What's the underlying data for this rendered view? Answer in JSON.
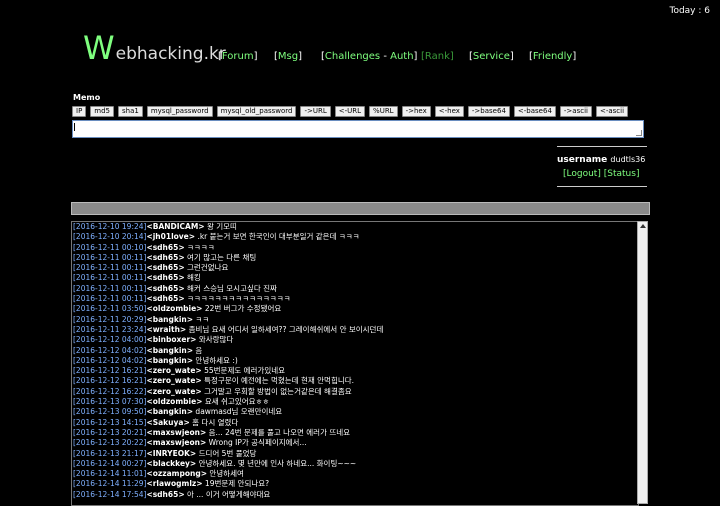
{
  "header": {
    "today": "Today : 6",
    "logo_big": "W",
    "logo_rest": "ebhacking.kr"
  },
  "nav": {
    "forum": "Forum",
    "msg": "Msg",
    "challenges": "Challenges",
    "dash": "-",
    "auth": "Auth",
    "rank": "Rank",
    "service": "Service",
    "friendly": "Friendly"
  },
  "memo": {
    "label": "Memo",
    "buttons": [
      "IP",
      "md5",
      "sha1",
      "mysql_password",
      "mysql_old_password",
      "->URL",
      "<-URL",
      "%URL",
      "->hex",
      "<-hex",
      "->base64",
      "<-base64",
      "->ascii",
      "<-ascii"
    ],
    "value": ""
  },
  "user": {
    "username_label": "username",
    "username_value": "dudtls36",
    "logout": "Logout",
    "status": "Status"
  },
  "chat": [
    {
      "ts": "[2016-12-10 19:24]",
      "name": "<BANDICAM>",
      "msg": " 왕 기모띠"
    },
    {
      "ts": "[2016-12-10 20:14]",
      "name": "<jh01love>",
      "msg": " .kr 붙는거 보면 한국인이 대부분일거 같은데 ㅋㅋㅋ"
    },
    {
      "ts": "[2016-12-11 00:10]",
      "name": "<sdh65>",
      "msg": " ㅋㅋㅋㅋ"
    },
    {
      "ts": "[2016-12-11 00:11]",
      "name": "<sdh65>",
      "msg": " 여기 많고는 다른 채팅"
    },
    {
      "ts": "[2016-12-11 00:11]",
      "name": "<sdh65>",
      "msg": " 그런건없나요"
    },
    {
      "ts": "[2016-12-11 00:11]",
      "name": "<sdh65>",
      "msg": " 해킹"
    },
    {
      "ts": "[2016-12-11 00:11]",
      "name": "<sdh65>",
      "msg": " 해커 스승님 모시고싶다 진짜"
    },
    {
      "ts": "[2016-12-11 00:11]",
      "name": "<sdh65>",
      "msg": " ㅋㅋㅋㅋㅋㅋㅋㅋㅋㅋㅋㅋㅋㅋㅋ"
    },
    {
      "ts": "[2016-12-11 03:50]",
      "name": "<oldzombie>",
      "msg": " 22번 버그가 수정됐어요"
    },
    {
      "ts": "[2016-12-11 20:29]",
      "name": "<bangkin>",
      "msg": " ㅋㅋ"
    },
    {
      "ts": "[2016-12-11 23:24]",
      "name": "<wraith>",
      "msg": " 좀비님 요새 어디서 일하세여?? 그레이해쉬에서 안 보이시던데"
    },
    {
      "ts": "[2016-12-12 04:00]",
      "name": "<binboxer>",
      "msg": " 와사랑많다"
    },
    {
      "ts": "[2016-12-12 04:02]",
      "name": "<bangkin>",
      "msg": " 음"
    },
    {
      "ts": "[2016-12-12 04:02]",
      "name": "<bangkin>",
      "msg": " 안녕하세요 :)"
    },
    {
      "ts": "[2016-12-12 16:21]",
      "name": "<zero_wate>",
      "msg": " 55번문제도 에러가있네요"
    },
    {
      "ts": "[2016-12-12 16:21]",
      "name": "<zero_wate>",
      "msg": " 특정구문이 예전에는 먹혔는데 현재 안먹힙니다."
    },
    {
      "ts": "[2016-12-12 16:22]",
      "name": "<zero_wate>",
      "msg": " 그거말고 우회할 방법이 없는거같은데 해결좀요"
    },
    {
      "ts": "[2016-12-13 07:30]",
      "name": "<oldzombie>",
      "msg": " 요새 쉬고있어요ㅎㅎ"
    },
    {
      "ts": "[2016-12-13 09:50]",
      "name": "<bangkin>",
      "msg": " dawmasd님 오랜만이네요"
    },
    {
      "ts": "[2016-12-13 14:15]",
      "name": "<Sakuya>",
      "msg": " 홈 다시 열렸다"
    },
    {
      "ts": "[2016-12-13 20:21]",
      "name": "<maxswjeon>",
      "msg": " 음... 24번 문제를 풀고 나오면 에러가 뜨네요"
    },
    {
      "ts": "[2016-12-13 20:22]",
      "name": "<maxswjeon>",
      "msg": " Wrong IP가 공식페이지에서..."
    },
    {
      "ts": "[2016-12-13 21:17]",
      "name": "<INRYEOK>",
      "msg": " 드디어 5번 풀었당"
    },
    {
      "ts": "[2016-12-14 00:27]",
      "name": "<blackkey>",
      "msg": " 안녕하세요. 몇 년만에 인사 하네요... 화이팅~~~"
    },
    {
      "ts": "[2016-12-14 11:01]",
      "name": "<ozzampong>",
      "msg": " 안녕하세여"
    },
    {
      "ts": "[2016-12-14 11:29]",
      "name": "<rlawogmlz>",
      "msg": " 19번문제 안되나요?"
    },
    {
      "ts": "[2016-12-14 17:54]",
      "name": "<sdh65>",
      "msg": " 아 ... 이거 어떻게해야대요"
    }
  ]
}
